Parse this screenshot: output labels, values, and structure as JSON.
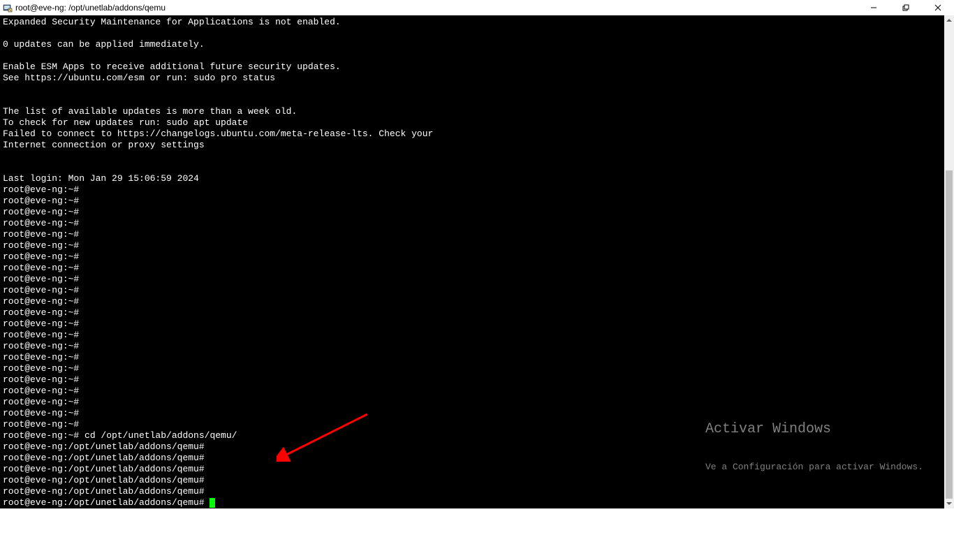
{
  "window": {
    "title": "root@eve-ng: /opt/unetlab/addons/qemu"
  },
  "terminal": {
    "lines": [
      "Expanded Security Maintenance for Applications is not enabled.",
      "",
      "0 updates can be applied immediately.",
      "",
      "Enable ESM Apps to receive additional future security updates.",
      "See https://ubuntu.com/esm or run: sudo pro status",
      "",
      "",
      "The list of available updates is more than a week old.",
      "To check for new updates run: sudo apt update",
      "Failed to connect to https://changelogs.ubuntu.com/meta-release-lts. Check your",
      "Internet connection or proxy settings",
      "",
      "",
      "Last login: Mon Jan 29 15:06:59 2024",
      "root@eve-ng:~#",
      "root@eve-ng:~#",
      "root@eve-ng:~#",
      "root@eve-ng:~#",
      "root@eve-ng:~#",
      "root@eve-ng:~#",
      "root@eve-ng:~#",
      "root@eve-ng:~#",
      "root@eve-ng:~#",
      "root@eve-ng:~#",
      "root@eve-ng:~#",
      "root@eve-ng:~#",
      "root@eve-ng:~#",
      "root@eve-ng:~#",
      "root@eve-ng:~#",
      "root@eve-ng:~#",
      "root@eve-ng:~#",
      "root@eve-ng:~#",
      "root@eve-ng:~#",
      "root@eve-ng:~#",
      "root@eve-ng:~#",
      "root@eve-ng:~#",
      "root@eve-ng:~# cd /opt/unetlab/addons/qemu/",
      "root@eve-ng:/opt/unetlab/addons/qemu#",
      "root@eve-ng:/opt/unetlab/addons/qemu#",
      "root@eve-ng:/opt/unetlab/addons/qemu#",
      "root@eve-ng:/opt/unetlab/addons/qemu#",
      "root@eve-ng:/opt/unetlab/addons/qemu#",
      "root@eve-ng:/opt/unetlab/addons/qemu# "
    ],
    "cursor_on_last": true
  },
  "watermark": {
    "title": "Activar Windows",
    "sub": "Ve a Configuración para activar Windows."
  }
}
